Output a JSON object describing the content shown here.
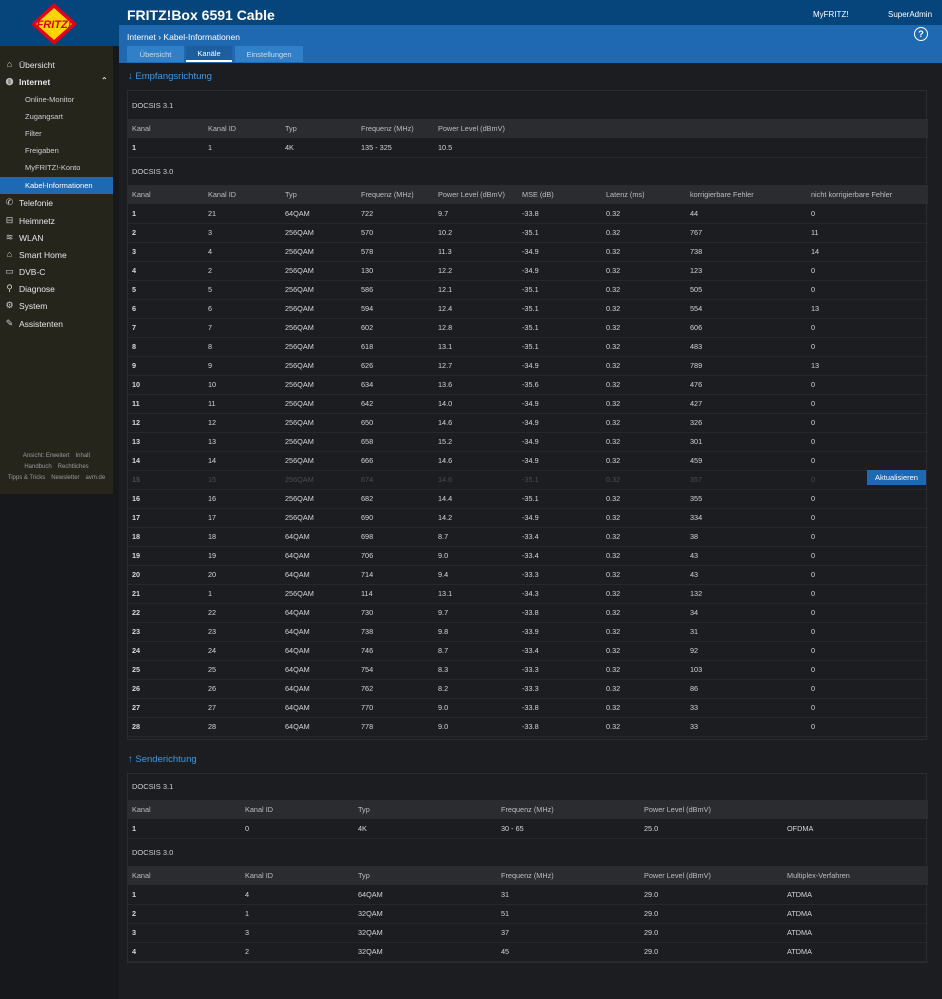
{
  "header": {
    "title": "FRITZ!Box 6591 Cable",
    "myfritz": "MyFRITZ!",
    "user": "SuperAdmin",
    "logo": "FRITZ!"
  },
  "sidebar": {
    "items": [
      {
        "label": "Übersicht",
        "icon": "home-icon",
        "level": 1
      },
      {
        "label": "Internet",
        "icon": "globe-icon",
        "level": 1,
        "expanded": true
      },
      {
        "label": "Online-Monitor",
        "level": 2
      },
      {
        "label": "Zugangsart",
        "level": 2
      },
      {
        "label": "Filter",
        "level": 2
      },
      {
        "label": "Freigaben",
        "level": 2
      },
      {
        "label": "MyFRITZ!-Konto",
        "level": 2
      },
      {
        "label": "Kabel-Informationen",
        "level": 2,
        "active": true
      },
      {
        "label": "Telefonie",
        "icon": "phone-icon",
        "level": 1
      },
      {
        "label": "Heimnetz",
        "icon": "network-icon",
        "level": 1
      },
      {
        "label": "WLAN",
        "icon": "wifi-icon",
        "level": 1
      },
      {
        "label": "Smart Home",
        "icon": "smarthome-icon",
        "level": 1
      },
      {
        "label": "DVB-C",
        "icon": "tv-icon",
        "level": 1
      },
      {
        "label": "Diagnose",
        "icon": "diagnose-icon",
        "level": 1
      },
      {
        "label": "System",
        "icon": "system-icon",
        "level": 1
      },
      {
        "label": "Assistenten",
        "icon": "wizard-icon",
        "level": 1
      }
    ],
    "footer": {
      "line1": [
        "Ansicht: Erweitert",
        "Inhalt"
      ],
      "line2": [
        "Handbuch",
        "Rechtliches"
      ],
      "line3": [
        "Tipps & Tricks",
        "Newsletter",
        "avm.de"
      ]
    }
  },
  "breadcrumb": {
    "parent": "Internet",
    "separator": "›",
    "current": "Kabel-Informationen"
  },
  "tabs": [
    {
      "label": "Übersicht"
    },
    {
      "label": "Kanäle",
      "selected": true
    },
    {
      "label": "Einstellungen"
    }
  ],
  "receive": {
    "heading": "↓ Empfangsrichtung",
    "docsis31": {
      "label": "DOCSIS 3.1",
      "headers": [
        "Kanal",
        "Kanal ID",
        "Typ",
        "Frequenz (MHz)",
        "Power Level (dBmV)"
      ],
      "rows": [
        [
          "1",
          "1",
          "4K",
          "135 - 325",
          "10.5"
        ]
      ]
    },
    "docsis30": {
      "label": "DOCSIS 3.0",
      "headers": [
        "Kanal",
        "Kanal ID",
        "Typ",
        "Frequenz (MHz)",
        "Power Level (dBmV)",
        "MSE (dB)",
        "Latenz (ms)",
        "korrigierbare Fehler",
        "nicht korrigierbare Fehler"
      ],
      "rows": [
        [
          "1",
          "21",
          "64QAM",
          "722",
          "9.7",
          "-33.8",
          "0.32",
          "44",
          "0"
        ],
        [
          "2",
          "3",
          "256QAM",
          "570",
          "10.2",
          "-35.1",
          "0.32",
          "767",
          "11"
        ],
        [
          "3",
          "4",
          "256QAM",
          "578",
          "11.3",
          "-34.9",
          "0.32",
          "738",
          "14"
        ],
        [
          "4",
          "2",
          "256QAM",
          "130",
          "12.2",
          "-34.9",
          "0.32",
          "123",
          "0"
        ],
        [
          "5",
          "5",
          "256QAM",
          "586",
          "12.1",
          "-35.1",
          "0.32",
          "505",
          "0"
        ],
        [
          "6",
          "6",
          "256QAM",
          "594",
          "12.4",
          "-35.1",
          "0.32",
          "554",
          "13"
        ],
        [
          "7",
          "7",
          "256QAM",
          "602",
          "12.8",
          "-35.1",
          "0.32",
          "606",
          "0"
        ],
        [
          "8",
          "8",
          "256QAM",
          "618",
          "13.1",
          "-35.1",
          "0.32",
          "483",
          "0"
        ],
        [
          "9",
          "9",
          "256QAM",
          "626",
          "12.7",
          "-34.9",
          "0.32",
          "789",
          "13"
        ],
        [
          "10",
          "10",
          "256QAM",
          "634",
          "13.6",
          "-35.6",
          "0.32",
          "476",
          "0"
        ],
        [
          "11",
          "11",
          "256QAM",
          "642",
          "14.0",
          "-34.9",
          "0.32",
          "427",
          "0"
        ],
        [
          "12",
          "12",
          "256QAM",
          "650",
          "14.6",
          "-34.9",
          "0.32",
          "326",
          "0"
        ],
        [
          "13",
          "13",
          "256QAM",
          "658",
          "15.2",
          "-34.9",
          "0.32",
          "301",
          "0"
        ],
        [
          "14",
          "14",
          "256QAM",
          "666",
          "14.6",
          "-34.9",
          "0.32",
          "459",
          "0"
        ],
        [
          "15",
          "15",
          "256QAM",
          "674",
          "14.6",
          "-35.1",
          "0.32",
          "357",
          "0"
        ],
        [
          "16",
          "16",
          "256QAM",
          "682",
          "14.4",
          "-35.1",
          "0.32",
          "355",
          "0"
        ],
        [
          "17",
          "17",
          "256QAM",
          "690",
          "14.2",
          "-34.9",
          "0.32",
          "334",
          "0"
        ],
        [
          "18",
          "18",
          "64QAM",
          "698",
          "8.7",
          "-33.4",
          "0.32",
          "38",
          "0"
        ],
        [
          "19",
          "19",
          "64QAM",
          "706",
          "9.0",
          "-33.4",
          "0.32",
          "43",
          "0"
        ],
        [
          "20",
          "20",
          "64QAM",
          "714",
          "9.4",
          "-33.3",
          "0.32",
          "43",
          "0"
        ],
        [
          "21",
          "1",
          "256QAM",
          "114",
          "13.1",
          "-34.3",
          "0.32",
          "132",
          "0"
        ],
        [
          "22",
          "22",
          "64QAM",
          "730",
          "9.7",
          "-33.8",
          "0.32",
          "34",
          "0"
        ],
        [
          "23",
          "23",
          "64QAM",
          "738",
          "9.8",
          "-33.9",
          "0.32",
          "31",
          "0"
        ],
        [
          "24",
          "24",
          "64QAM",
          "746",
          "8.7",
          "-33.4",
          "0.32",
          "92",
          "0"
        ],
        [
          "25",
          "25",
          "64QAM",
          "754",
          "8.3",
          "-33.3",
          "0.32",
          "103",
          "0"
        ],
        [
          "26",
          "26",
          "64QAM",
          "762",
          "8.2",
          "-33.3",
          "0.32",
          "86",
          "0"
        ],
        [
          "27",
          "27",
          "64QAM",
          "770",
          "9.0",
          "-33.8",
          "0.32",
          "33",
          "0"
        ],
        [
          "28",
          "28",
          "64QAM",
          "778",
          "9.0",
          "-33.8",
          "0.32",
          "33",
          "0"
        ]
      ]
    }
  },
  "send": {
    "heading": "↑ Senderichtung",
    "docsis31": {
      "label": "DOCSIS 3.1",
      "headers": [
        "Kanal",
        "Kanal ID",
        "Typ",
        "Frequenz (MHz)",
        "Power Level (dBmV)",
        ""
      ],
      "rows": [
        [
          "1",
          "0",
          "4K",
          "30 - 65",
          "25.0",
          "OFDMA"
        ]
      ]
    },
    "docsis30": {
      "label": "DOCSIS 3.0",
      "headers": [
        "Kanal",
        "Kanal ID",
        "Typ",
        "Frequenz (MHz)",
        "Power Level (dBmV)",
        "Multiplex-Verfahren"
      ],
      "rows": [
        [
          "1",
          "4",
          "64QAM",
          "31",
          "29.0",
          "ATDMA"
        ],
        [
          "2",
          "1",
          "32QAM",
          "51",
          "29.0",
          "ATDMA"
        ],
        [
          "3",
          "3",
          "32QAM",
          "37",
          "29.0",
          "ATDMA"
        ],
        [
          "4",
          "2",
          "32QAM",
          "45",
          "29.0",
          "ATDMA"
        ]
      ]
    }
  },
  "update_button": "Aktualisieren",
  "colors": {
    "header": "#06447c",
    "accent": "#1f69b2",
    "link": "#3f9ae6",
    "background": "#1b1d20"
  }
}
